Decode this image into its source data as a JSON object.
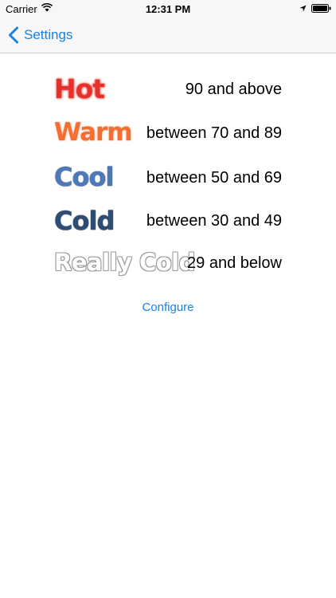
{
  "status_bar": {
    "carrier": "Carrier",
    "time": "12:31 PM",
    "icons": [
      "wifi-icon",
      "location-icon",
      "battery-icon"
    ]
  },
  "nav": {
    "back_label": "Settings",
    "back_icon": "chevron-left-icon"
  },
  "temperatures": [
    {
      "name": "Hot",
      "range": "90 and above",
      "color": "#e4312c"
    },
    {
      "name": "Warm",
      "range": "between 70 and 89",
      "color": "#f36d34"
    },
    {
      "name": "Cool",
      "range": "between 50 and 69",
      "color": "#4f78b7"
    },
    {
      "name": "Cold",
      "range": "between 30 and 49",
      "color": "#2d4d73"
    },
    {
      "name": "Really Cold",
      "range": "29 and below",
      "color": "#ffffff"
    }
  ],
  "configure_label": "Configure",
  "colors": {
    "accent": "#1a82e6",
    "bar_background": "#f7f7f7"
  }
}
